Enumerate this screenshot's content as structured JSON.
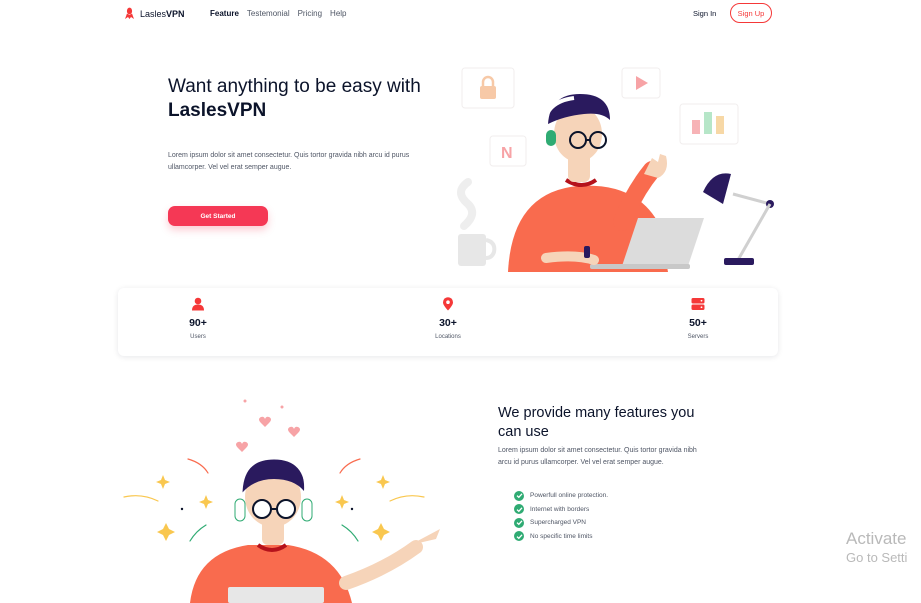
{
  "nav": {
    "brand_prefix": "Lasles",
    "brand_suffix": "VPN",
    "items": [
      "Feature",
      "Testemonial",
      "Pricing",
      "Help"
    ],
    "active_item": "Feature",
    "signin": "Sign In",
    "signup": "Sign Up"
  },
  "hero": {
    "title": "Want anything to be easy with",
    "title_brand": "LaslesVPN",
    "description": "Lorem ipsum dolor sit amet consectetur. Quis tortor gravida nibh arcu id purus ullamcorper. Vel vel erat semper augue.",
    "cta": "Get Started"
  },
  "stats": [
    {
      "icon": "user-icon",
      "value": "90+",
      "label": "Users"
    },
    {
      "icon": "location-icon",
      "value": "30+",
      "label": "Locations"
    },
    {
      "icon": "server-icon",
      "value": "50+",
      "label": "Servers"
    }
  ],
  "features": {
    "title": "We provide many features you can use",
    "description": "Lorem ipsum dolor sit amet consectetur. Quis tortor gravida nibh arcu id purus ullamcorper. Vel vel erat semper augue.",
    "items": [
      "Powerfull online protection.",
      "Internet with borders",
      "Supercharged VPN",
      "No specific time limits"
    ]
  },
  "watermark": {
    "line1": "Activate",
    "line2": "Go to Setti"
  },
  "colors": {
    "accent": "#f53855",
    "accent_outline": "#f53838",
    "check_green": "#2fab73",
    "text_dark": "#0b132a",
    "text_muted": "#4f5665"
  }
}
